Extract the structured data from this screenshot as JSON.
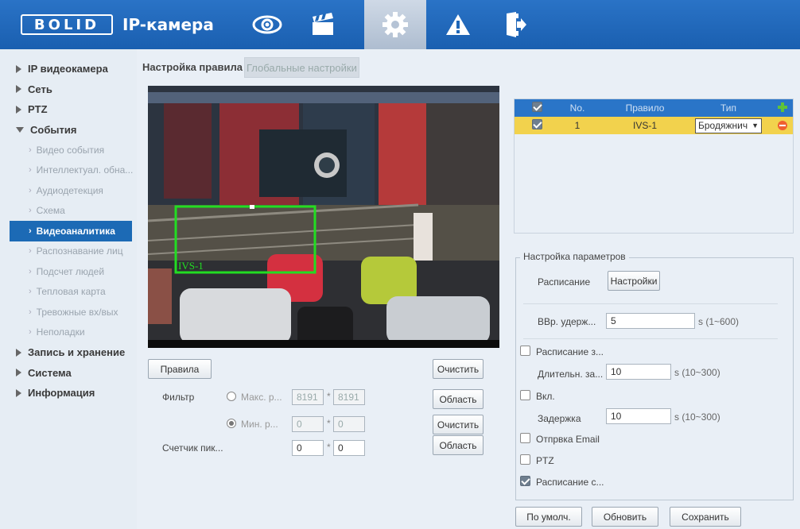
{
  "header": {
    "logo": "BOLID",
    "title": "IP-камера",
    "nav": [
      "live-view-icon",
      "playback-icon",
      "settings-icon",
      "alarm-icon",
      "logout-icon"
    ]
  },
  "sidebar": {
    "groups": [
      {
        "label": "IP видеокамера",
        "expanded": false
      },
      {
        "label": "Сеть",
        "expanded": false
      },
      {
        "label": "PTZ",
        "expanded": false
      },
      {
        "label": "События",
        "expanded": true
      }
    ],
    "events_items": [
      "Видео события",
      "Интеллектуал. обна...",
      "Аудиодетекция",
      "Схема",
      "Видеоаналитика",
      "Распознавание лиц",
      "Подсчет людей",
      "Тепловая карта",
      "Тревожные вх/вых",
      "Неполадки"
    ],
    "bottom_groups": [
      "Запись и хранение",
      "Система",
      "Информация"
    ]
  },
  "tabs": {
    "rule_setup": "Настройка правила",
    "global": "Глобальные настройки"
  },
  "video": {
    "rule_label": "IVS-1"
  },
  "left_controls": {
    "rules_button": "Правила",
    "clear_button": "Очистить",
    "filter_label": "Фильтр",
    "max_label": "Макс. р...",
    "max_w": "8191",
    "max_h": "8191",
    "min_label": "Мин. р...",
    "min_w": "0",
    "min_h": "0",
    "star": "*",
    "area_button": "Область",
    "clear_button_2": "Очистить",
    "pixel_counter_label": "Счетчик пик...",
    "pix_w": "0",
    "pix_h": "0",
    "area_button_2": "Область"
  },
  "rule_table": {
    "headers": {
      "no": "No.",
      "rule": "Правило",
      "type": "Тип"
    },
    "rows": [
      {
        "no": "1",
        "rule": "IVS-1",
        "type": "Бродяжнич"
      }
    ]
  },
  "params": {
    "title": "Настройка параметров",
    "schedule_label": "Расписание",
    "settings_button": "Настройки",
    "hold_label": "ВВр. удерж...",
    "hold_value": "5",
    "hold_range": "s (1~600)",
    "schedule_rec_label": "Расписание з...",
    "duration_label": "Длительн. за...",
    "duration_value": "10",
    "duration_range": "s (10~300)",
    "enable_label": "Вкл.",
    "delay_label": "Задержка",
    "delay_value": "10",
    "delay_range": "s (10~300)",
    "email_label": "Отпрвка Email",
    "ptz_label": "PTZ",
    "schedule_snap_label": "Расписание с..."
  },
  "footer_buttons": {
    "default": "По умолч.",
    "refresh": "Обновить",
    "save": "Сохранить"
  },
  "colors": {
    "header": "#1f67b8",
    "selected_row": "#f2d24d",
    "table_header": "#2a75c8",
    "detection_box": "#22dd22"
  }
}
